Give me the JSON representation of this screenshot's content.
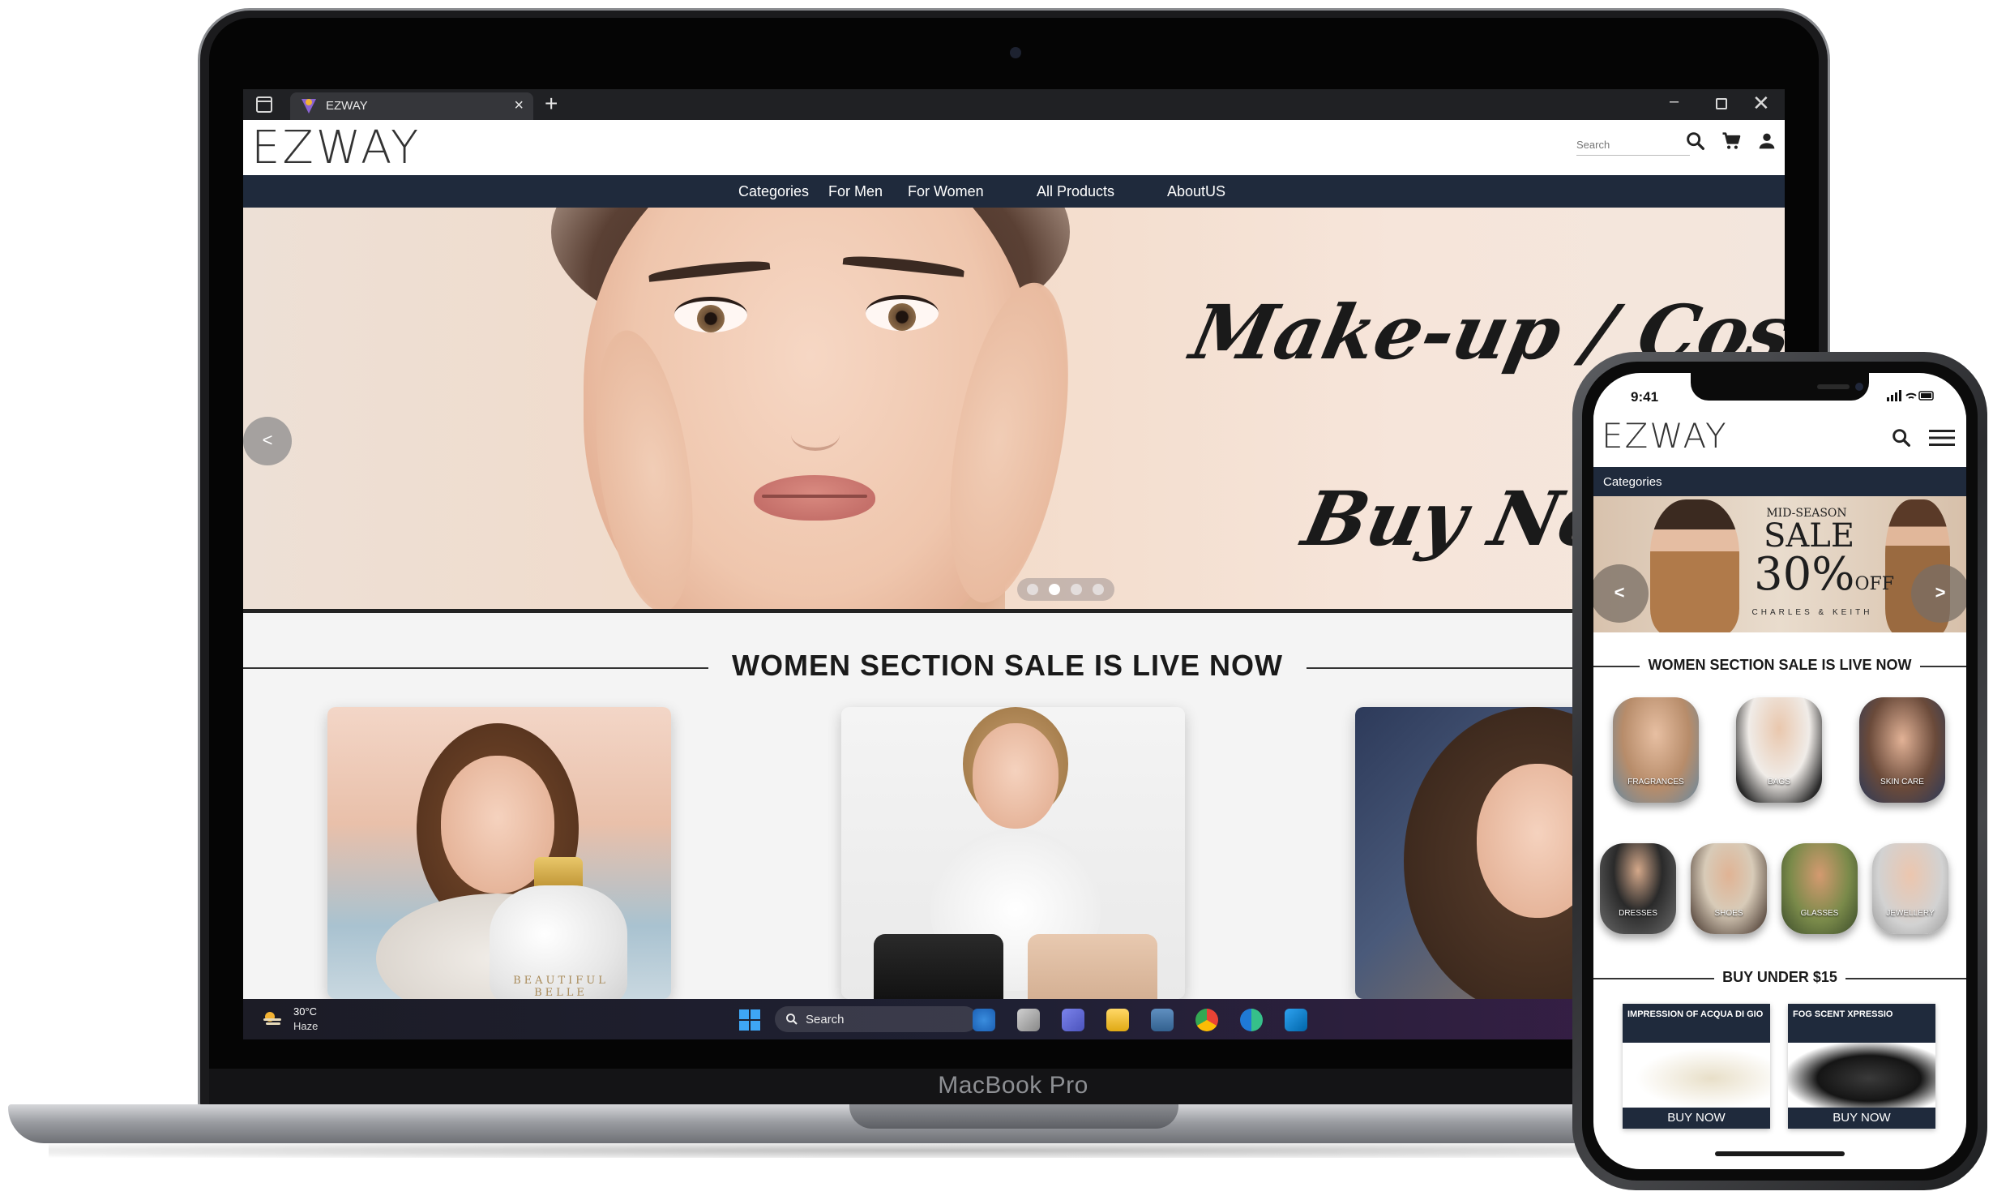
{
  "laptop": {
    "brand": "MacBook Pro"
  },
  "browser": {
    "tab_title": "EZWAY",
    "new_tab": "+",
    "tab_close": "×",
    "window_min": "–",
    "window_close": "✕"
  },
  "site": {
    "logo": "EZWAY",
    "search_placeholder": "Search",
    "nav": [
      "Categories",
      "For Men",
      "For Women",
      "All Products",
      "AboutUS"
    ],
    "hero": {
      "line1": "Make-up / Cosmetics",
      "line2": "Buy Now",
      "prev": "<",
      "slide_count": 4,
      "active_slide": 2
    },
    "section_title": "WOMEN SECTION SALE IS LIVE NOW",
    "card_bottle_text": "BEAUTIFUL BELLE"
  },
  "taskbar": {
    "temperature": "30°C",
    "weather": "Haze",
    "search_label": "Search",
    "apps": [
      "bing-icon",
      "task-view-icon",
      "teams-icon",
      "file-explorer-icon",
      "postgres-icon",
      "chrome-icon",
      "edge-icon",
      "vscode-icon"
    ]
  },
  "phone": {
    "time": "9:41",
    "logo": "EZWAY",
    "categories_label": "Categories",
    "banner": {
      "small": "MID-SEASON",
      "big": "SALE",
      "percent": "30%",
      "off": "OFF",
      "brand": "CHARLES & KEITH",
      "prev": "<",
      "next": ">"
    },
    "section_title": "WOMEN SECTION SALE IS LIVE NOW",
    "categories": [
      "FRAGRANCES",
      "BAGS",
      "SKIN CARE",
      "DRESSES",
      "SHOES",
      "GLASSES",
      "JEWELLERY"
    ],
    "buy_title": "BUY UNDER $15",
    "products": [
      {
        "name": "IMPRESSION OF ACQUA DI GIO",
        "button": "BUY NOW"
      },
      {
        "name": "FOG SCENT XPRESSIO",
        "button": "BUY NOW"
      }
    ]
  },
  "colors": {
    "nav_bg": "#1f2a3c",
    "hero_bg": "#f2d9c6",
    "text_dark": "#1a1a1a"
  }
}
